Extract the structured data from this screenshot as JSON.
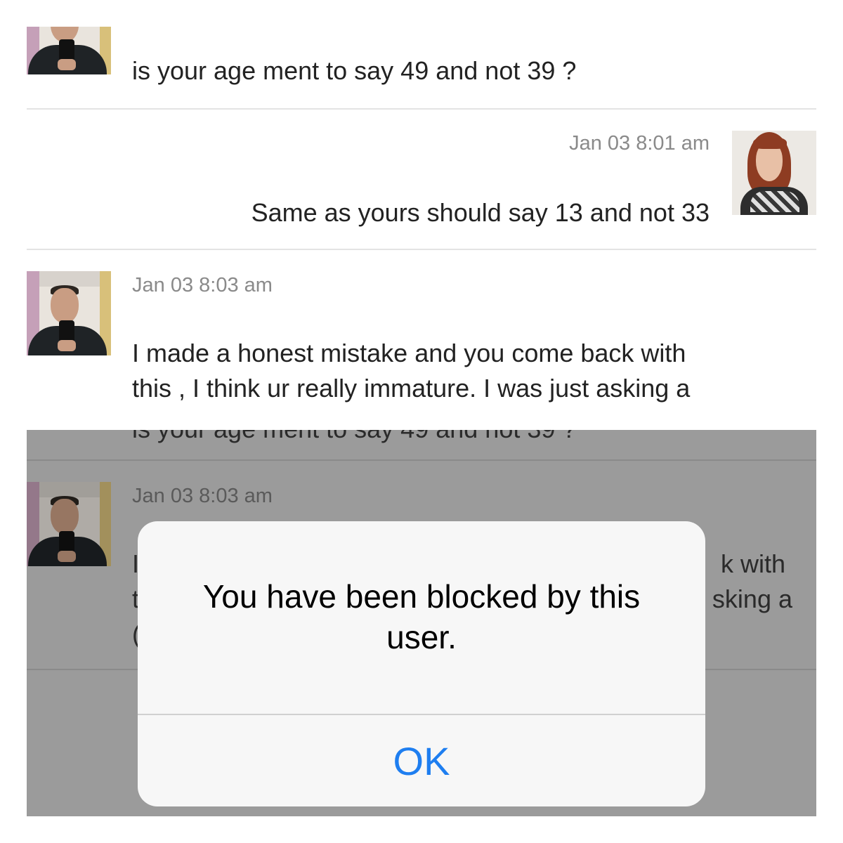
{
  "top_conversation": {
    "messages": [
      {
        "sender": "male",
        "time": "",
        "text_lines": [
          "is your age ment to say 49 and not 39 ?"
        ]
      },
      {
        "sender": "female",
        "time": "Jan 03 8:01 am",
        "text_lines": [
          "Same as yours should say 13 and not 33"
        ]
      },
      {
        "sender": "male",
        "time": "Jan 03 8:03 am",
        "text_lines": [
          "I made a honest mistake and you come back with",
          "this , I think ur really immature.  I was just asking a"
        ]
      }
    ]
  },
  "bottom_conversation": {
    "cutoff_text": "is your age ment to say 49 and not 39 ?",
    "message": {
      "sender": "male",
      "time": "Jan 03 8:03 am",
      "visible_left_chars": [
        "I",
        "t",
        "("
      ],
      "visible_right_fragments": [
        "k with",
        "sking a"
      ]
    }
  },
  "alert": {
    "message": "You have been blocked by this user.",
    "ok_label": "OK"
  },
  "colors": {
    "accent_blue": "#1e7ef0",
    "dim_background": "#9b9b9b"
  }
}
